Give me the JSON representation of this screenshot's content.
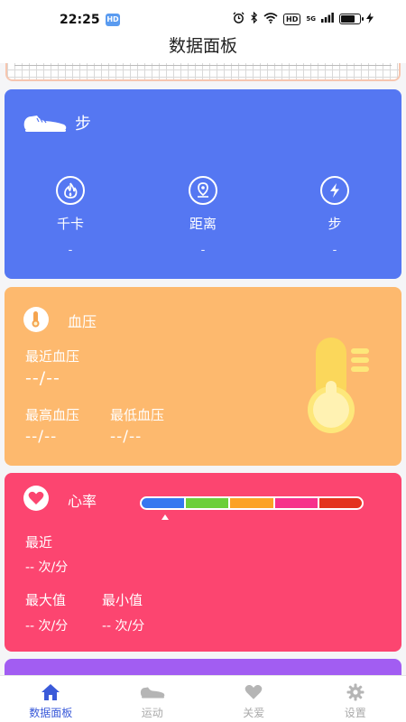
{
  "status_bar": {
    "time": "22:25",
    "app_badge": "HD",
    "network": "5G",
    "hd_label": "HD",
    "battery_level": 0.75
  },
  "header": {
    "title": "数据面板"
  },
  "steps_card": {
    "title": "步",
    "color": "#5577f2",
    "stats": [
      {
        "icon": "flame-icon",
        "label": "千卡",
        "value": "-"
      },
      {
        "icon": "location-icon",
        "label": "距离",
        "value": "-"
      },
      {
        "icon": "lightning-icon",
        "label": "步",
        "value": "-"
      }
    ]
  },
  "bp_card": {
    "title": "血压",
    "color": "#fdb96e",
    "recent_label": "最近血压",
    "recent_value": "--/--",
    "max_label": "最高血压",
    "max_value": "--/--",
    "min_label": "最低血压",
    "min_value": "--/--"
  },
  "hr_card": {
    "title": "心率",
    "color": "#fc4570",
    "scale_colors": [
      "#3577f0",
      "#6dcf3a",
      "#fca225",
      "#f7308b",
      "#e4321e"
    ],
    "recent_label": "最近",
    "recent_value": "-- 次/分",
    "max_label": "最大值",
    "max_value": "-- 次/分",
    "min_label": "最小值",
    "min_value": "-- 次/分"
  },
  "nav": {
    "items": [
      {
        "label": "数据面板",
        "icon": "home-icon",
        "active": true
      },
      {
        "label": "运动",
        "icon": "shoe-icon",
        "active": false
      },
      {
        "label": "关爱",
        "icon": "heart-icon",
        "active": false
      },
      {
        "label": "设置",
        "icon": "gear-icon",
        "active": false
      }
    ]
  }
}
